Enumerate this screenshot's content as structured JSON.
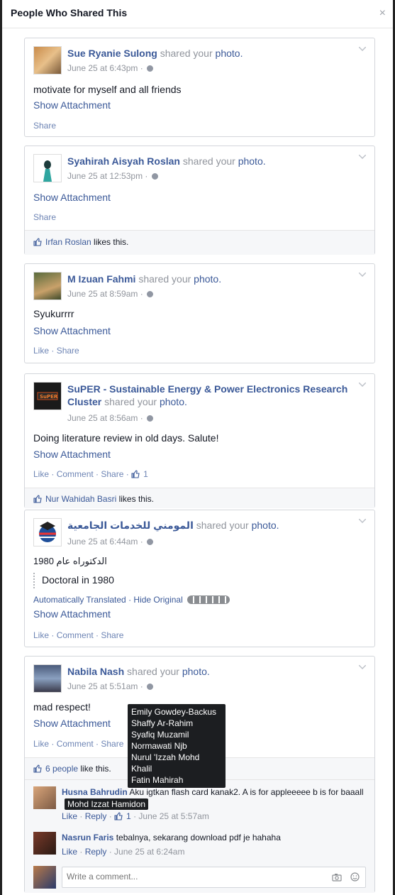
{
  "dialog": {
    "title": "People Who Shared This",
    "close_label": "×"
  },
  "common": {
    "shared_your": "shared your",
    "photo": "photo.",
    "show_attachment": "Show Attachment",
    "share": "Share",
    "like": "Like",
    "comment": "Comment",
    "dot": " · "
  },
  "posts": [
    {
      "author": "Sue Ryanie Sulong",
      "time": "June 25 at 6:43pm ·",
      "text": "motivate for myself and all friends"
    },
    {
      "author": "Syahirah Aisyah Roslan",
      "time": "June 25 at 12:53pm ·",
      "liker": "Irfan Roslan",
      "likes_suffix": " likes this."
    },
    {
      "author": "M Izuan Fahmi",
      "time": "June 25 at 8:59am ·",
      "text": "Syukurrrr"
    },
    {
      "author_line1": "SuPER - Sustainable Energy & Power Electronics Research",
      "author_line2": "Cluster",
      "time": "June 25 at 8:56am ·",
      "text": "Doing literature review in old days. Salute!",
      "like_count": "1",
      "liker": "Nur Wahidah Basri",
      "likes_suffix": " likes this."
    },
    {
      "author": "المومني للخدمات الجامعية",
      "time": "June 25 at 6:44am ·",
      "original": "1980 الدكتوراه عام",
      "translation": "Doctoral in 1980",
      "auto_translated": "Automatically Translated",
      "hide_original": "Hide Original"
    },
    {
      "author": "Nabila Nash",
      "time": "June 25 at 5:51am ·",
      "text": "mad respect!",
      "likes_people": "6 people",
      "likes_suffix": " like this."
    }
  ],
  "tooltip_names": [
    "Emily Gowdey-Backus",
    "Shaffy Ar-Rahim",
    "Syafiq Muzamil",
    "Normawati Njb",
    "Nurul 'Izzah Mohd Khalil",
    "Fatin Mahirah"
  ],
  "comments": [
    {
      "name": "Husna Bahrudin",
      "text": "Aku igtkan flash card kanak2. A is for appleeeee b is for baaall",
      "tag": "Mohd Izzat Hamidon",
      "like": "Like",
      "reply": "Reply",
      "like_count": "1",
      "time": "June 25 at 5:57am"
    },
    {
      "name": "Nasrun Faris",
      "text": "tebalnya, sekarang download pdf je hahaha",
      "like": "Like",
      "reply": "Reply",
      "time": "June 25 at 6:24am"
    }
  ],
  "write_comment": {
    "placeholder": "Write a comment..."
  },
  "icons": {
    "camera": "camera-icon",
    "emoji": "emoji-icon",
    "globe": "globe-icon",
    "thumb": "thumbs-up-icon",
    "chevron": "chevron-down-icon"
  },
  "colors": {
    "link": "#3b5998",
    "muted": "#90949c",
    "border": "#d3d6db"
  }
}
